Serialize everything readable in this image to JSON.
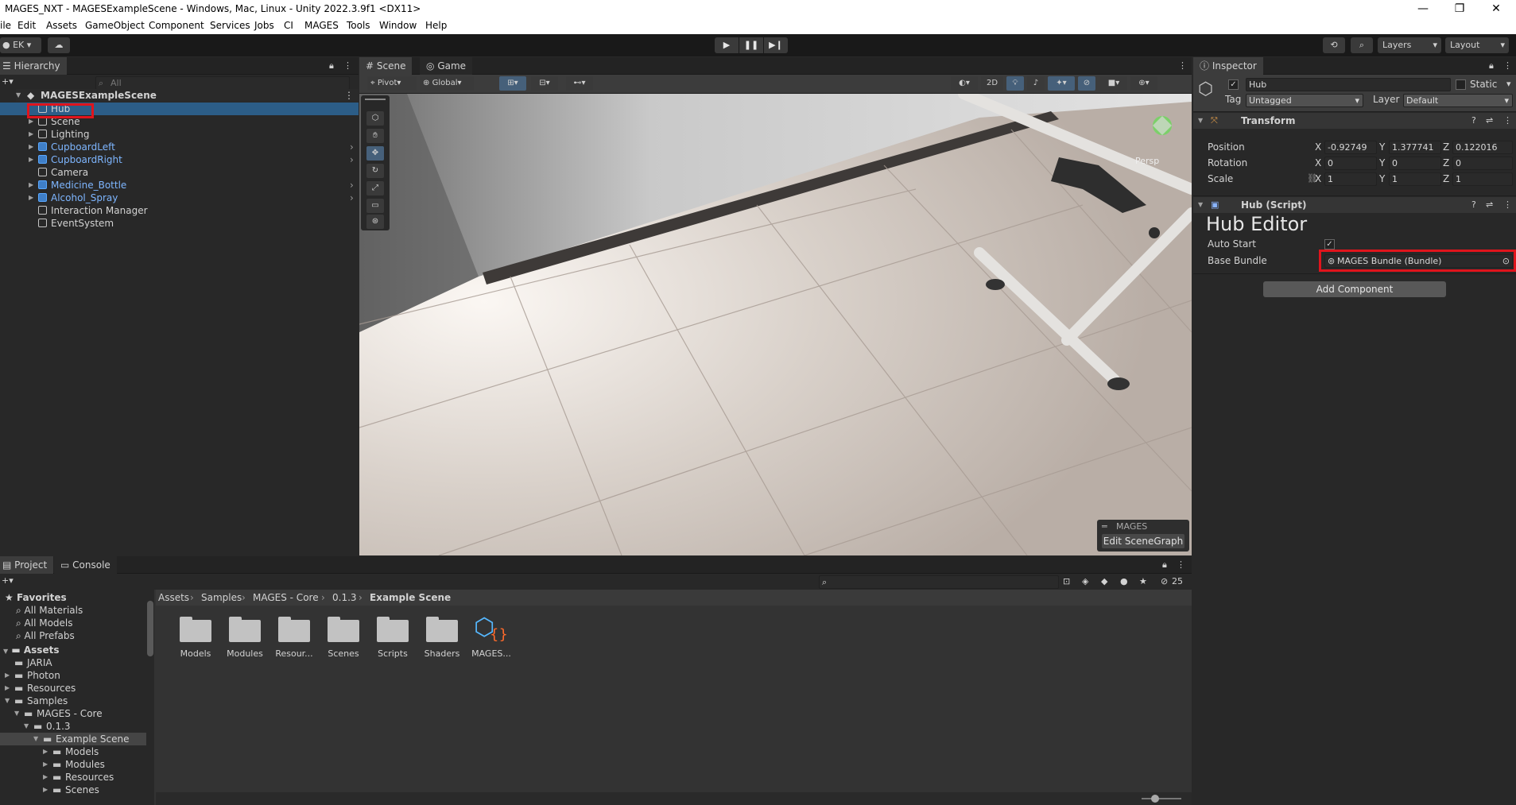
{
  "window": {
    "title": "MAGES_NXT - MAGESExampleScene - Windows, Mac, Linux - Unity 2022.3.9f1 <DX11>",
    "controls": [
      "—",
      "❐",
      "✕"
    ]
  },
  "menu": [
    "ile",
    "Edit",
    "Assets",
    "GameObject",
    "Component",
    "Services",
    "Jobs",
    "CI",
    "MAGES",
    "Tools",
    "Window",
    "Help"
  ],
  "toolbar": {
    "account": "EK",
    "layers_label": "Layers",
    "layout_label": "Layout"
  },
  "hierarchy": {
    "tab": "Hierarchy",
    "search_placeholder": "All",
    "scene_root": "MAGESExampleScene",
    "items": [
      {
        "label": "Hub",
        "selected": true,
        "prefab": false,
        "expandable": false
      },
      {
        "label": "Scene",
        "prefab": false,
        "expandable": true
      },
      {
        "label": "Lighting",
        "prefab": false,
        "expandable": true
      },
      {
        "label": "CupboardLeft",
        "prefab": true,
        "expandable": true
      },
      {
        "label": "CupboardRight",
        "prefab": true,
        "expandable": true
      },
      {
        "label": "Camera",
        "prefab": false,
        "expandable": false
      },
      {
        "label": "Medicine_Bottle",
        "prefab": true,
        "expandable": true
      },
      {
        "label": "Alcohol_Spray",
        "prefab": true,
        "expandable": true
      },
      {
        "label": "Interaction Manager",
        "prefab": false,
        "expandable": false
      },
      {
        "label": "EventSystem",
        "prefab": false,
        "expandable": false
      }
    ]
  },
  "scene_view": {
    "tabs": [
      "Scene",
      "Game"
    ],
    "pivot": "Pivot",
    "global": "Global",
    "mode_2d": "2D",
    "persp": "Persp",
    "overlay_title": "MAGES",
    "overlay_button": "Edit SceneGraph"
  },
  "inspector": {
    "tab": "Inspector",
    "object_name": "Hub",
    "static_label": "Static",
    "tag_label": "Tag",
    "tag_value": "Untagged",
    "layer_label": "Layer",
    "layer_value": "Default",
    "transform": {
      "title": "Transform",
      "position_label": "Position",
      "rotation_label": "Rotation",
      "scale_label": "Scale",
      "position": {
        "x": "-0.92749",
        "y": "1.377741",
        "z": "0.122016"
      },
      "rotation": {
        "x": "0",
        "y": "0",
        "z": "0"
      },
      "scale": {
        "x": "1",
        "y": "1",
        "z": "1"
      }
    },
    "script": {
      "title": "Hub (Script)",
      "editor_title": "Hub Editor",
      "auto_start_label": "Auto Start",
      "base_bundle_label": "Base Bundle",
      "base_bundle_value": "MAGES Bundle (Bundle)"
    },
    "add_component": "Add Component"
  },
  "project": {
    "tabs": [
      "Project",
      "Console"
    ],
    "hidden_count": "25",
    "breadcrumb": [
      "Assets",
      "Samples",
      "MAGES - Core",
      "0.1.3",
      "Example Scene"
    ],
    "favorites_label": "Favorites",
    "favorites": [
      "All Materials",
      "All Models",
      "All Prefabs"
    ],
    "assets_label": "Assets",
    "tree": [
      {
        "label": "JARIA",
        "indent": 1,
        "expand": false
      },
      {
        "label": "Photon",
        "indent": 1,
        "expand": true
      },
      {
        "label": "Resources",
        "indent": 1,
        "expand": true
      },
      {
        "label": "Samples",
        "indent": 1,
        "expand": "open"
      },
      {
        "label": "MAGES - Core",
        "indent": 2,
        "expand": "open"
      },
      {
        "label": "0.1.3",
        "indent": 3,
        "expand": "open"
      },
      {
        "label": "Example Scene",
        "indent": 4,
        "expand": "open",
        "selected": true
      },
      {
        "label": "Models",
        "indent": 5,
        "expand": true
      },
      {
        "label": "Modules",
        "indent": 5,
        "expand": true
      },
      {
        "label": "Resources",
        "indent": 5,
        "expand": true
      },
      {
        "label": "Scenes",
        "indent": 5,
        "expand": true
      }
    ],
    "files": [
      "Models",
      "Modules",
      "Resour...",
      "Scenes",
      "Scripts",
      "Shaders",
      "MAGES..."
    ]
  },
  "colors": {
    "highlight_red": "#e0141c",
    "selection_blue": "#2c5d87",
    "prefab_blue": "#7eb6ff"
  }
}
